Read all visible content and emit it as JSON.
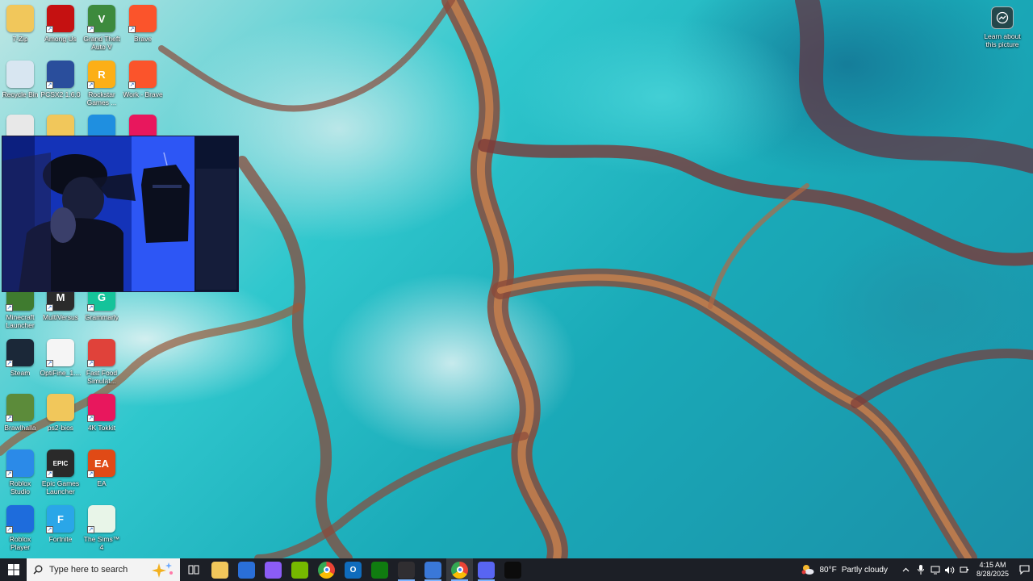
{
  "desktop": {
    "icons": [
      {
        "label": "7-Zip",
        "color": "#f1c75b",
        "glyph": ""
      },
      {
        "label": "Among Us",
        "color": "#c51111",
        "glyph": ""
      },
      {
        "label": "Grand Theft Auto V",
        "color": "#3d8a3d",
        "glyph": "V"
      },
      {
        "label": "Brave",
        "color": "#fb542b",
        "glyph": ""
      },
      {
        "label": "Recycle Bin",
        "color": "#d8e6f1",
        "glyph": ""
      },
      {
        "label": "PCSX2 1.6.0",
        "color": "#2a4e9c",
        "glyph": ""
      },
      {
        "label": "Rockstar Games ...",
        "color": "#fcaf17",
        "glyph": "R"
      },
      {
        "label": "Work - Brave",
        "color": "#fb542b",
        "glyph": ""
      },
      {
        "label": "Minecraft Launcher",
        "color": "#3f7b2f",
        "glyph": ""
      },
      {
        "label": "MultiVersus",
        "color": "#2b2b2b",
        "glyph": "M"
      },
      {
        "label": "Grammarly",
        "color": "#15c39a",
        "glyph": "G"
      },
      {
        "label": "Steam",
        "color": "#1b2838",
        "glyph": ""
      },
      {
        "label": "OptiFine_1....",
        "color": "#f5f5f5",
        "glyph": ""
      },
      {
        "label": "Fast Food Simulat...",
        "color": "#e0423a",
        "glyph": ""
      },
      {
        "label": "Brawlhalla",
        "color": "#5c8b3a",
        "glyph": ""
      },
      {
        "label": "ps2-bios",
        "color": "#f1c75b",
        "glyph": ""
      },
      {
        "label": "4K Tokkit",
        "color": "#e8175d",
        "glyph": ""
      },
      {
        "label": "Roblox Studio",
        "color": "#2b8ae8",
        "glyph": ""
      },
      {
        "label": "Epic Games Launcher",
        "color": "#2a2a2a",
        "glyph": "EPIC"
      },
      {
        "label": "EA",
        "color": "#e04a16",
        "glyph": "EA"
      },
      {
        "label": "Roblox Player",
        "color": "#1e6cdc",
        "glyph": ""
      },
      {
        "label": "Fortnite",
        "color": "#2aa6e8",
        "glyph": "F"
      },
      {
        "label": "The Sims™ 4",
        "color": "#e8f5e8",
        "glyph": ""
      }
    ],
    "partial_row": [
      {
        "name": "chrome",
        "color": "#e8e8e8"
      },
      {
        "name": "folder",
        "color": "#f1c75b"
      },
      {
        "name": "edge",
        "color": "#1f8fe0"
      },
      {
        "name": "tiktok",
        "color": "#e8175d"
      }
    ],
    "learn_about": "Learn about this picture"
  },
  "taskbar": {
    "search_placeholder": "Type here to search",
    "apps": [
      {
        "name": "task-view",
        "color": "transparent",
        "glyph": ""
      },
      {
        "name": "file-explorer",
        "color": "#f1c75b",
        "glyph": ""
      },
      {
        "name": "microsoft-store",
        "color": "#2a6fd8",
        "glyph": ""
      },
      {
        "name": "copilot",
        "color": "#8b5cf6",
        "glyph": ""
      },
      {
        "name": "nvidia",
        "color": "#76b900",
        "glyph": ""
      },
      {
        "name": "chrome",
        "color": "#dcdcdc",
        "glyph": ""
      },
      {
        "name": "outlook",
        "color": "#0f6cbd",
        "glyph": "O"
      },
      {
        "name": "xbox",
        "color": "#107c10",
        "glyph": ""
      },
      {
        "name": "obs",
        "color": "#302e31",
        "glyph": ""
      },
      {
        "name": "app-shield",
        "color": "#3a78d8",
        "glyph": ""
      },
      {
        "name": "chrome-alt",
        "color": "#dcdcdc",
        "glyph": ""
      },
      {
        "name": "discord",
        "color": "#5865f2",
        "glyph": ""
      },
      {
        "name": "terminal",
        "color": "#0c0c0c",
        "glyph": ""
      }
    ],
    "weather": {
      "temp": "80°F",
      "condition": "Partly cloudy"
    },
    "clock": {
      "time": "4:15 AM",
      "date": "8/28/2025"
    }
  }
}
